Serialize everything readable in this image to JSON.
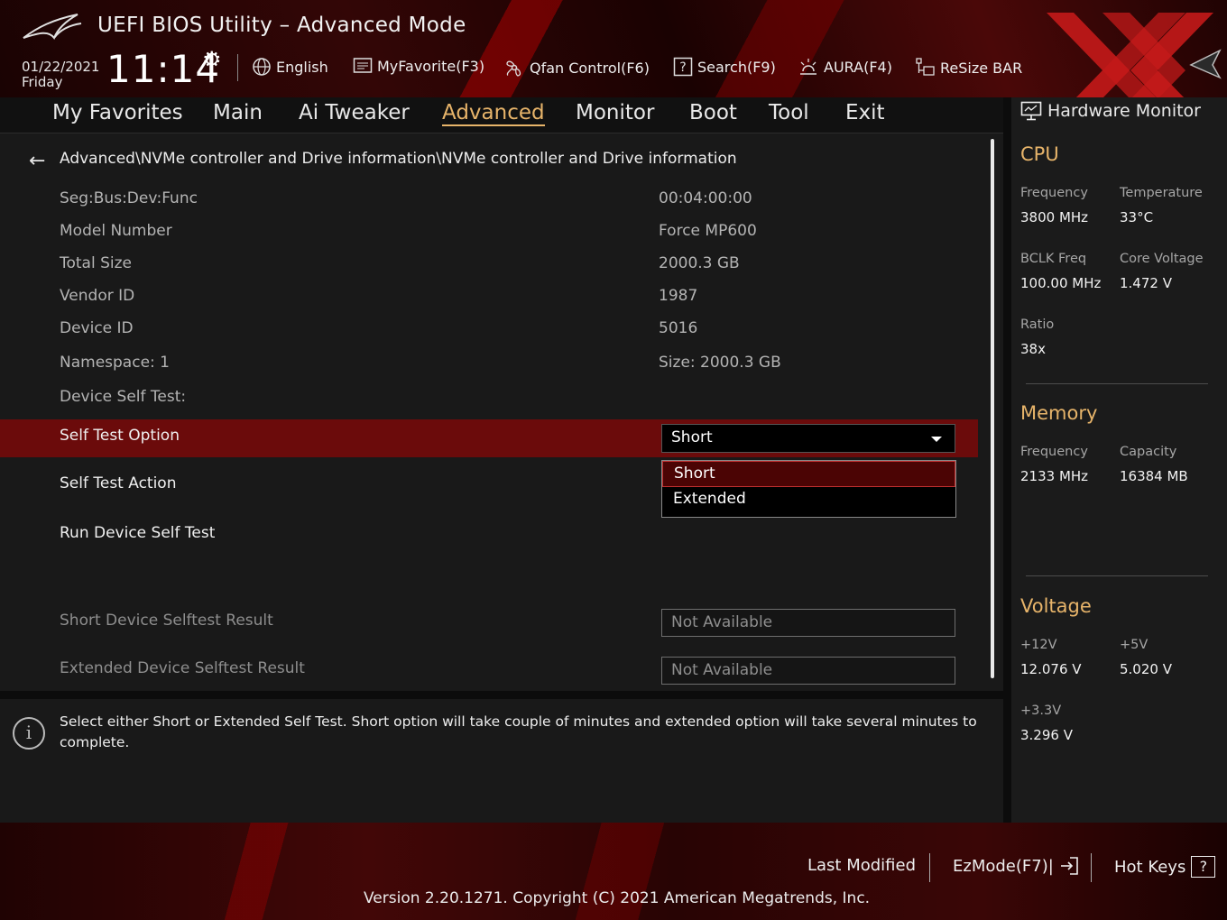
{
  "header": {
    "title": "UEFI BIOS Utility – Advanced Mode",
    "date": "01/22/2021",
    "day": "Friday",
    "time": "11:14",
    "toolbar": [
      {
        "label": "English",
        "icon": "globe-icon"
      },
      {
        "label": "MyFavorite(F3)",
        "icon": "favorite-list-icon"
      },
      {
        "label": "Qfan Control(F6)",
        "icon": "fan-icon"
      },
      {
        "label": "Search(F9)",
        "icon": "search-help-icon"
      },
      {
        "label": "AURA(F4)",
        "icon": "aura-light-icon"
      },
      {
        "label": "ReSize BAR",
        "icon": "resize-bar-icon"
      }
    ]
  },
  "nav": {
    "tabs": [
      "My Favorites",
      "Main",
      "Ai Tweaker",
      "Advanced",
      "Monitor",
      "Boot",
      "Tool",
      "Exit"
    ],
    "active": "Advanced"
  },
  "main": {
    "breadcrumb": "Advanced\\NVMe controller and Drive information\\NVMe controller and Drive information",
    "info_rows": [
      {
        "label": "Seg:Bus:Dev:Func",
        "value": "00:04:00:00"
      },
      {
        "label": "Model Number",
        "value": "Force MP600"
      },
      {
        "label": "Total Size",
        "value": "2000.3 GB"
      },
      {
        "label": "Vendor ID",
        "value": "1987"
      },
      {
        "label": "Device ID",
        "value": "5016"
      },
      {
        "label": "Namespace: 1",
        "value": "Size: 2000.3 GB"
      }
    ],
    "self_test_heading": "Device Self Test:",
    "self_test_option": {
      "label": "Self Test Option",
      "value": "Short",
      "options": [
        "Short",
        "Extended"
      ]
    },
    "self_test_action": "Self Test Action",
    "run_self_test": "Run Device Self Test",
    "short_result": {
      "label": "Short Device Selftest Result",
      "value": "Not Available"
    },
    "extended_result": {
      "label": "Extended Device Selftest Result",
      "value": "Not Available"
    }
  },
  "help": {
    "text": "Select either Short or Extended Self Test. Short option will take couple of minutes and extended option will take several minutes to complete."
  },
  "hw_monitor": {
    "title": "Hardware Monitor",
    "cpu": {
      "title": "CPU",
      "frequency_label": "Frequency",
      "frequency": "3800 MHz",
      "temperature_label": "Temperature",
      "temperature": "33°C",
      "bclk_label": "BCLK Freq",
      "bclk": "100.00 MHz",
      "core_voltage_label": "Core Voltage",
      "core_voltage": "1.472 V",
      "ratio_label": "Ratio",
      "ratio": "38x"
    },
    "memory": {
      "title": "Memory",
      "frequency_label": "Frequency",
      "frequency": "2133 MHz",
      "capacity_label": "Capacity",
      "capacity": "16384 MB"
    },
    "voltage": {
      "title": "Voltage",
      "v12_label": "+12V",
      "v12": "12.076 V",
      "v5_label": "+5V",
      "v5": "5.020 V",
      "v33_label": "+3.3V",
      "v33": "3.296 V"
    }
  },
  "footer": {
    "last_modified": "Last Modified",
    "ezmode": "EzMode(F7)|",
    "hot_keys": "Hot Keys",
    "hot_keys_key": "?",
    "version": "Version 2.20.1271. Copyright (C) 2021 American Megatrends, Inc."
  },
  "colors": {
    "accent": "#e7b46a",
    "selected_row": "#6b0b0b",
    "brand_red": "#c41a1a"
  }
}
